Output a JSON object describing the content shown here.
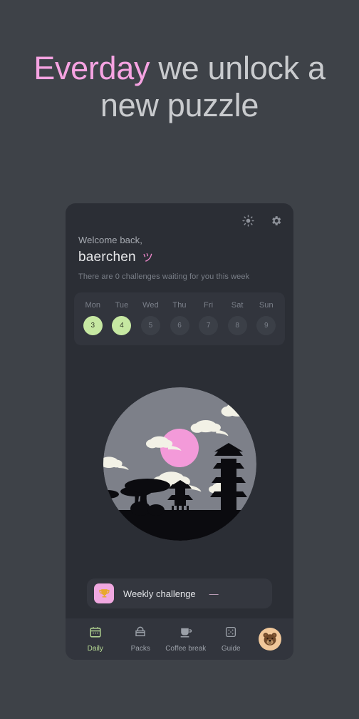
{
  "headline": {
    "accent_word": "Everday",
    "rest": " we unlock a new puzzle"
  },
  "card": {
    "top_icons": [
      {
        "name": "brightness-icon",
        "label": "Brightness"
      },
      {
        "name": "settings-icon",
        "label": "Settings"
      }
    ],
    "greeting": {
      "welcome": "Welcome back,",
      "username": "baerchen",
      "emoticon": "ツ",
      "subline": "There are 0 challenges waiting for you this week"
    },
    "week": {
      "days": [
        {
          "name": "Mon",
          "num": "3",
          "active": true
        },
        {
          "name": "Tue",
          "num": "4",
          "active": true
        },
        {
          "name": "Wed",
          "num": "5",
          "active": false
        },
        {
          "name": "Thu",
          "num": "6",
          "active": false
        },
        {
          "name": "Fri",
          "num": "7",
          "active": false
        },
        {
          "name": "Sat",
          "num": "8",
          "active": false
        },
        {
          "name": "Sun",
          "num": "9",
          "active": false
        }
      ]
    },
    "illustration": {
      "alt": "Night scene with pink moon, clouds, pagodas and bonsai trees",
      "moon_color": "#f39ad9",
      "sky_color": "#7d8089"
    },
    "challenge": {
      "icon": "trophy-icon",
      "label": "Weekly challenge",
      "dash": "—"
    },
    "nav": {
      "items": [
        {
          "label": "Daily",
          "icon": "calendar-icon",
          "active": true
        },
        {
          "label": "Packs",
          "icon": "gift-bag-icon",
          "active": false
        },
        {
          "label": "Coffee break",
          "icon": "coffee-cup-icon",
          "active": false
        },
        {
          "label": "Guide",
          "icon": "dice-icon",
          "active": false
        }
      ],
      "avatar": {
        "name": "bear-avatar"
      }
    }
  },
  "colors": {
    "page_bg": "#3e4248",
    "card_bg": "#2b2e35",
    "accent_pink": "#f6a3e2",
    "accent_green": "#c6e8a2"
  }
}
